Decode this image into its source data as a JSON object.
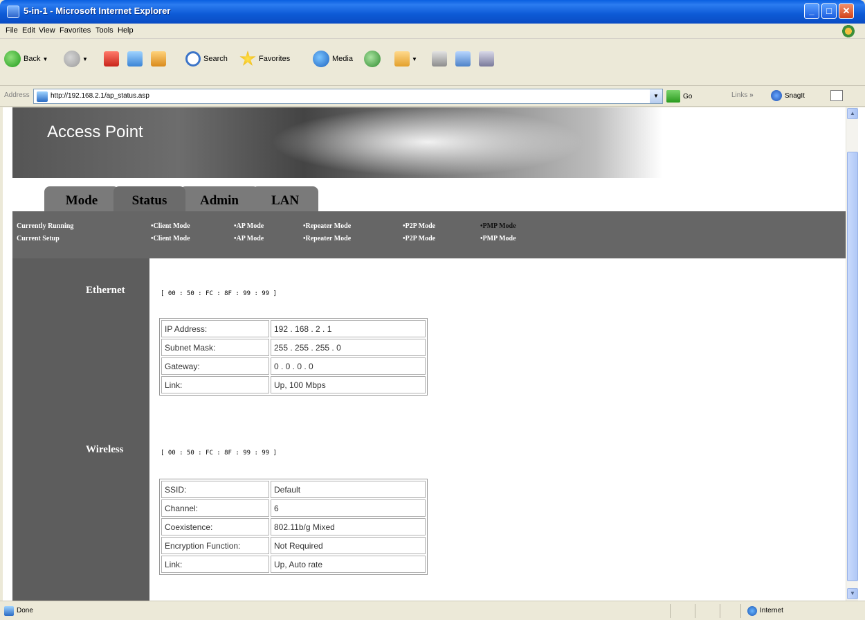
{
  "window": {
    "title": "5-in-1 - Microsoft Internet Explorer"
  },
  "menu": [
    "File",
    "Edit",
    "View",
    "Favorites",
    "Tools",
    "Help"
  ],
  "toolbar": {
    "back": "Back",
    "search": "Search",
    "favorites": "Favorites",
    "media": "Media"
  },
  "address": {
    "label": "Address",
    "url": "http://192.168.2.1/ap_status.asp",
    "go": "Go",
    "links": "Links",
    "links_chevron": "»",
    "snagit": "SnagIt"
  },
  "page": {
    "banner_title": "Access Point",
    "tabs": [
      "Mode",
      "Status",
      "Admin",
      "LAN"
    ],
    "subnav": {
      "rows": [
        "Currently Running",
        "Current Setup"
      ],
      "modes": [
        "•Client Mode",
        "•AP Mode",
        "•Repeater Mode",
        "•P2P Mode",
        "•PMP Mode"
      ]
    },
    "ethernet": {
      "label": "Ethernet",
      "mac": "[ 00 : 50 : FC : 8F : 99 : 99 ]",
      "rows": [
        [
          "IP Address:",
          "192 . 168 . 2 . 1"
        ],
        [
          "Subnet Mask:",
          "255 . 255 . 255 . 0"
        ],
        [
          "Gateway:",
          "0 . 0 . 0 . 0"
        ],
        [
          "Link:",
          "Up, 100 Mbps"
        ]
      ]
    },
    "wireless": {
      "label": "Wireless",
      "mac": "[ 00 : 50 : FC : 8F : 99 : 99 ]",
      "rows": [
        [
          "SSID:",
          "Default"
        ],
        [
          "Channel:",
          "6"
        ],
        [
          "Coexistence:",
          "802.11b/g Mixed"
        ],
        [
          "Encryption Function:",
          "Not Required"
        ],
        [
          "Link:",
          "Up,  Auto rate"
        ]
      ]
    }
  },
  "status": {
    "text": "Done",
    "zone": "Internet"
  },
  "colors": {
    "titlebar": "#0a5fe0",
    "nav_bg": "#666666",
    "left_bg": "#5d5d5d",
    "tab_bg": "#7a7a7a"
  }
}
